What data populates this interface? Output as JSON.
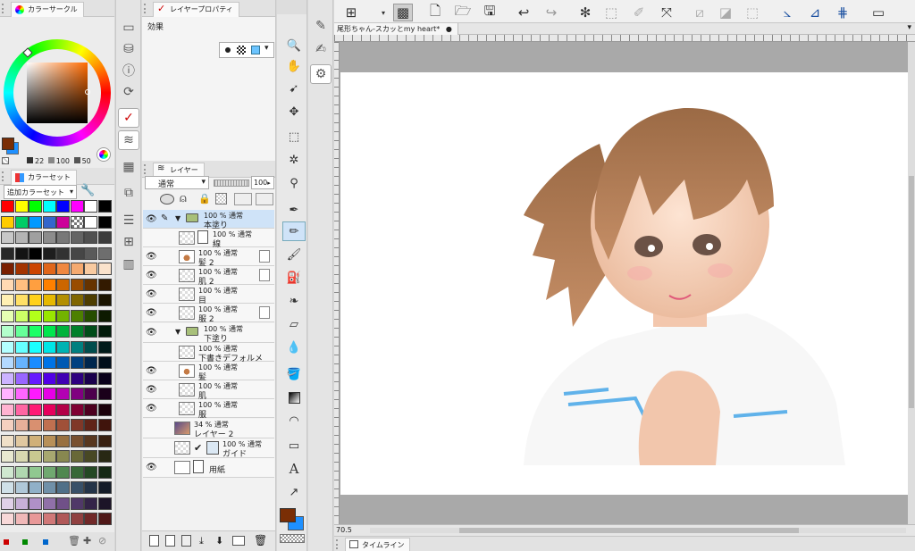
{
  "color_circle": {
    "title": "カラーサークル",
    "values": [
      "22",
      "100",
      "50"
    ],
    "main_color": "#7a2e05",
    "sub_color": "#1e90ff"
  },
  "color_set": {
    "title": "カラーセット",
    "dropdown": "追加カラーセット"
  },
  "layer_property": {
    "title": "レイヤープロパティ",
    "effect_label": "効果"
  },
  "layer_panel": {
    "title": "レイヤー",
    "blend_mode": "通常",
    "opacity": "100",
    "layers": [
      {
        "name": "本塗り",
        "info": "100 % 通常",
        "type": "folder",
        "selected": true
      },
      {
        "name": "線",
        "info": "100 % 通常"
      },
      {
        "name": "髪 2",
        "info": "100 % 通常"
      },
      {
        "name": "肌 2",
        "info": "100 % 通常"
      },
      {
        "name": "目",
        "info": "100 % 通常"
      },
      {
        "name": "服 2",
        "info": "100 % 通常"
      },
      {
        "name": "下塗り",
        "info": "100 % 通常",
        "type": "folder"
      },
      {
        "name": "下書きデフォルメ",
        "info": "100 % 通常"
      },
      {
        "name": "髪",
        "info": "100 % 通常"
      },
      {
        "name": "肌",
        "info": "100 % 通常"
      },
      {
        "name": "服",
        "info": "100 % 通常"
      },
      {
        "name": "レイヤー 2",
        "info": "34 % 通常"
      },
      {
        "name": "ガイド",
        "info": "100 % 通常"
      },
      {
        "name": "用紙",
        "info": ""
      }
    ]
  },
  "canvas": {
    "tab_title": "尾形ちゃん-スカッとmy heart*",
    "zoom_readout": "70.5"
  },
  "timeline": {
    "label": "タイムライン"
  }
}
